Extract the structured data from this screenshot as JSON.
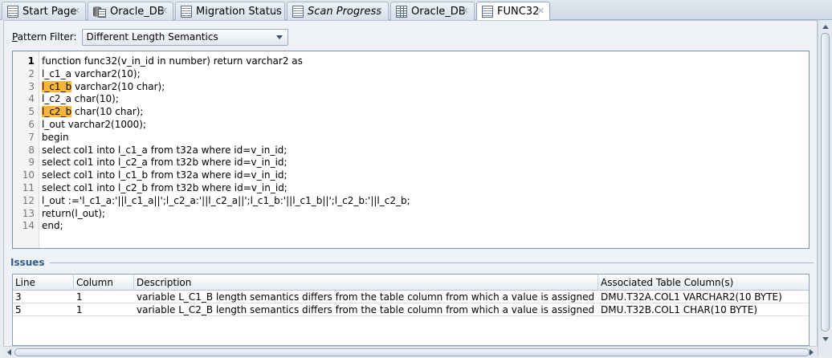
{
  "tabs": [
    {
      "label": "Start Page",
      "icon": "document-icon",
      "italic": false
    },
    {
      "label": "Oracle_DB",
      "icon": "database-icon",
      "italic": false
    },
    {
      "label": "Migration Status",
      "icon": "document-icon",
      "italic": false
    },
    {
      "label": "Scan Progress",
      "icon": "document-icon",
      "italic": true
    },
    {
      "label": "Oracle_DB",
      "icon": "grid-icon",
      "italic": false
    },
    {
      "label": "FUNC32",
      "icon": "document-icon",
      "italic": false,
      "active": true
    }
  ],
  "filter": {
    "label_mnemonic": "P",
    "label_rest": "attern Filter:",
    "selected": "Different Length Semantics"
  },
  "editor": {
    "current_line": 1,
    "highlight_color": "#f5b63a",
    "lines": [
      {
        "num": "1",
        "pre": "function func32(v_in_id in number) return varchar2 as",
        "hl": "",
        "post": ""
      },
      {
        "num": "2",
        "pre": "l_c1_a varchar2(10);",
        "hl": "",
        "post": ""
      },
      {
        "num": "3",
        "pre": "",
        "hl": "l_c1_b",
        "post": " varchar2(10 char);"
      },
      {
        "num": "4",
        "pre": "l_c2_a char(10);",
        "hl": "",
        "post": ""
      },
      {
        "num": "5",
        "pre": "",
        "hl": "l_c2_b",
        "post": " char(10 char);"
      },
      {
        "num": "6",
        "pre": "l_out varchar2(1000);",
        "hl": "",
        "post": ""
      },
      {
        "num": "7",
        "pre": "begin",
        "hl": "",
        "post": ""
      },
      {
        "num": "8",
        "pre": "select col1 into l_c1_a from t32a where id=v_in_id;",
        "hl": "",
        "post": ""
      },
      {
        "num": "9",
        "pre": "select col1 into l_c2_a from t32b where id=v_in_id;",
        "hl": "",
        "post": ""
      },
      {
        "num": "10",
        "pre": "select col1 into l_c1_b from t32a where id=v_in_id;",
        "hl": "",
        "post": ""
      },
      {
        "num": "11",
        "pre": "select col1 into l_c2_b from t32b where id=v_in_id;",
        "hl": "",
        "post": ""
      },
      {
        "num": "12",
        "pre": "l_out :='l_c1_a:'||l_c1_a||';l_c2_a:'||l_c2_a||';l_c1_b:'||l_c1_b||';l_c2_b:'||l_c2_b;",
        "hl": "",
        "post": ""
      },
      {
        "num": "13",
        "pre": "return(l_out);",
        "hl": "",
        "post": ""
      },
      {
        "num": "14",
        "pre": "end;",
        "hl": "",
        "post": ""
      }
    ]
  },
  "issues": {
    "title": "Issues",
    "columns": [
      "Line",
      "Column",
      "Description",
      "Associated Table Column(s)"
    ],
    "rows": [
      {
        "line": "3",
        "column": "1",
        "description": "variable L_C1_B length semantics differs from the table column from which a value is assigned",
        "assoc": "DMU.T32A.COL1 VARCHAR2(10 BYTE)"
      },
      {
        "line": "5",
        "column": "1",
        "description": "variable L_C2_B length semantics differs from the table column from which a value is assigned",
        "assoc": "DMU.T32B.COL1 CHAR(10 BYTE)"
      }
    ]
  }
}
